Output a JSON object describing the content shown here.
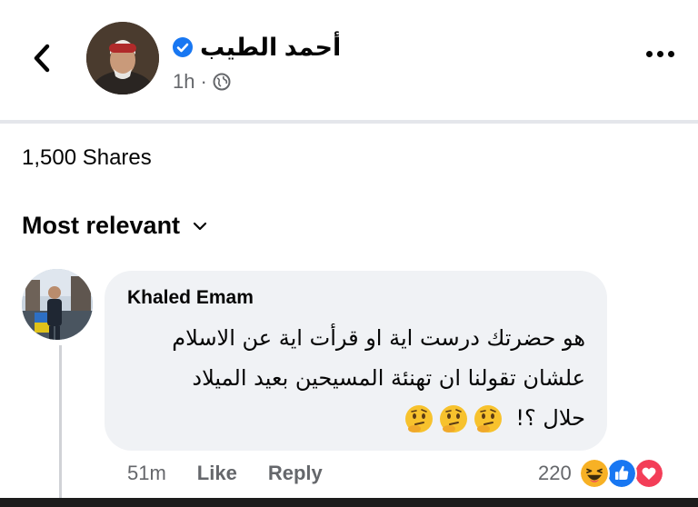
{
  "post": {
    "author": "أحمد الطيب",
    "time": "1h",
    "shares": "1,500 Shares"
  },
  "comments_header": {
    "sort_label": "Most relevant"
  },
  "comment": {
    "author": "Khaled Emam",
    "line1": "هو حضرتك درست اية او قرأت اية عن الاسلام",
    "line2": "علشان تقولنا ان تهنئة المسيحين بعيد الميلاد",
    "line3": "حلال ؟!",
    "emojis": [
      "thinking-face-icon",
      "thinking-face-icon",
      "thinking-face-icon"
    ],
    "time": "51m",
    "like_label": "Like",
    "reply_label": "Reply",
    "reaction_count": "220",
    "reaction_icons": [
      "haha-icon",
      "like-icon",
      "love-icon"
    ]
  },
  "colors": {
    "verified": "#1877f2",
    "secondary_text": "#65676b",
    "bubble": "#f0f2f5",
    "love": "#f33e58",
    "haha": "#f7b125"
  }
}
